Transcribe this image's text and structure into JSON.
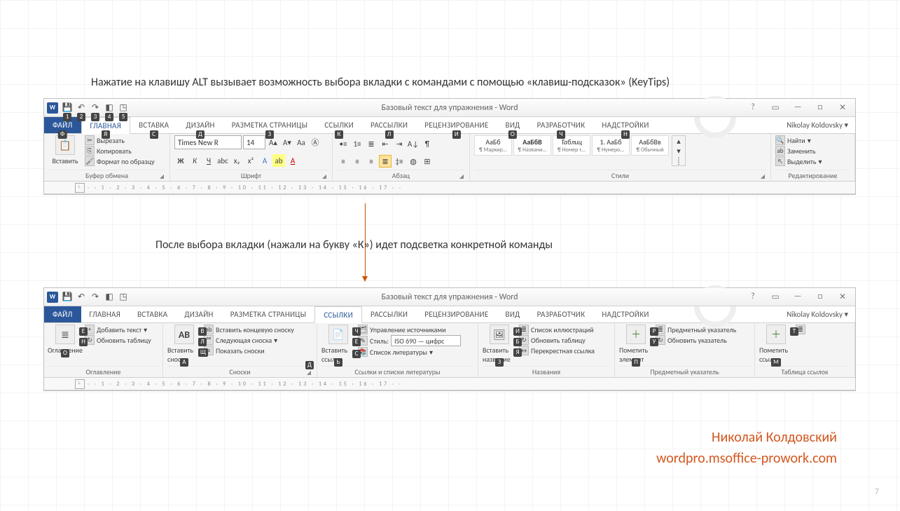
{
  "caption1": "Нажатие на клавишу ALT вызывает возможность выбора вкладки с командами с помощью «клавиш-подсказок» (KeyTips)",
  "caption2": "После выбора вкладки (нажали на букву «К») идет подсветка конкретной команды",
  "author_name": "Николай Колдовский",
  "author_url": "wordpro.msoffice-prowork.com",
  "page_number": "7",
  "qat_keys": [
    "1",
    "2",
    "3",
    "4",
    "5"
  ],
  "win1": {
    "title": "Базовый текст для упражнения - Word",
    "user": "Nikolay Koldovsky",
    "tabs": [
      {
        "label": "ФАЙЛ",
        "key": "Ф",
        "type": "file"
      },
      {
        "label": "ГЛАВНАЯ",
        "key": "Я",
        "type": "active"
      },
      {
        "label": "ВСТАВКА",
        "key": "С"
      },
      {
        "label": "ДИЗАЙН",
        "key": "Д"
      },
      {
        "label": "РАЗМЕТКА СТРАНИЦЫ",
        "key": "З"
      },
      {
        "label": "ССЫЛКИ",
        "key": "К"
      },
      {
        "label": "РАССЫЛКИ",
        "key": "Л"
      },
      {
        "label": "РЕЦЕНЗИРОВАНИЕ",
        "key": "И"
      },
      {
        "label": "ВИД",
        "key": "О"
      },
      {
        "label": "РАЗРАБОТЧИК",
        "key": "Ч"
      },
      {
        "label": "НАДСТРОЙКИ",
        "key": "Н"
      }
    ],
    "clipboard": {
      "group": "Буфер обмена",
      "paste": "Вставить",
      "cut": "Вырезать",
      "copy": "Копировать",
      "format": "Формат по образцу"
    },
    "font": {
      "group": "Шрифт",
      "name": "Times New R",
      "size": "14"
    },
    "paragraph": {
      "group": "Абзац"
    },
    "styles": {
      "group": "Стили",
      "items": [
        {
          "sample": "АаБб",
          "lbl": "¶ Маркир..."
        },
        {
          "sample": "АаБбВ",
          "lbl": "¶ Названи...",
          "bold": true
        },
        {
          "sample": "Таблиц",
          "lbl": "¶ Номер т...",
          "ital": true
        },
        {
          "sample": "1. АаБб",
          "lbl": "¶ Нумеро..."
        },
        {
          "sample": "АаБбВв",
          "lbl": "¶ Обычный"
        }
      ]
    },
    "editing": {
      "group": "Редактирование",
      "find": "Найти",
      "replace": "Заменить",
      "select": "Выделить"
    }
  },
  "win2": {
    "title": "Базовый текст для упражнения - Word",
    "user": "Nikolay Koldovsky",
    "tabs": [
      {
        "label": "ФАЙЛ",
        "type": "file"
      },
      {
        "label": "ГЛАВНАЯ"
      },
      {
        "label": "ВСТАВКА"
      },
      {
        "label": "ДИЗАЙН"
      },
      {
        "label": "РАЗМЕТКА СТРАНИЦЫ"
      },
      {
        "label": "ССЫЛКИ",
        "type": "active"
      },
      {
        "label": "РАССЫЛКИ"
      },
      {
        "label": "РЕЦЕНЗИРОВАНИЕ"
      },
      {
        "label": "ВИД"
      },
      {
        "label": "РАЗРАБОТЧИК"
      },
      {
        "label": "НАДСТРОЙКИ"
      }
    ],
    "toc": {
      "group": "Оглавление",
      "main": "Оглавление",
      "add": "Добавить текст",
      "upd": "Обновить таблицу",
      "keys": {
        "main": "О",
        "add": "Е",
        "upd": "Н"
      }
    },
    "footnotes": {
      "group": "Сноски",
      "ab": "AB",
      "insert": "Вставить сноску",
      "end": "Вставить концевую сноску",
      "next": "Следующая сноска",
      "show": "Показать сноски",
      "keys": {
        "insert": "А",
        "end": "В",
        "next": "Л",
        "show": "Щ",
        "launcher": "Д"
      }
    },
    "citations": {
      "group": "Ссылки и списки литературы",
      "insert": "Вставить ссылку",
      "manage": "Управление источниками",
      "style": "Стиль:",
      "style_val": "ISO 690 — цифрс",
      "bib": "Список литературы",
      "keys": {
        "insert": "Ь",
        "manage": "Ч",
        "style": "Е",
        "bib": "С"
      }
    },
    "captions": {
      "group": "Названия",
      "insert": "Вставить название",
      "fig": "Список иллюстраций",
      "upd": "Обновить таблицу",
      "cross": "Перекрестная ссылка",
      "keys": {
        "insert": "З",
        "fig": "И",
        "upd": "Б",
        "cross": "Я"
      }
    },
    "index": {
      "group": "Предметный указатель",
      "mark": "Пометить элемент",
      "ins": "Предметный указатель",
      "upd": "Обновить указатель",
      "keys": {
        "mark": "П",
        "ins": "Р",
        "upd": "У"
      }
    },
    "toa": {
      "group": "Таблица ссылок",
      "mark": "Пометить ссылку",
      "keys": {
        "mark": "М",
        "ins": "Т"
      }
    }
  }
}
